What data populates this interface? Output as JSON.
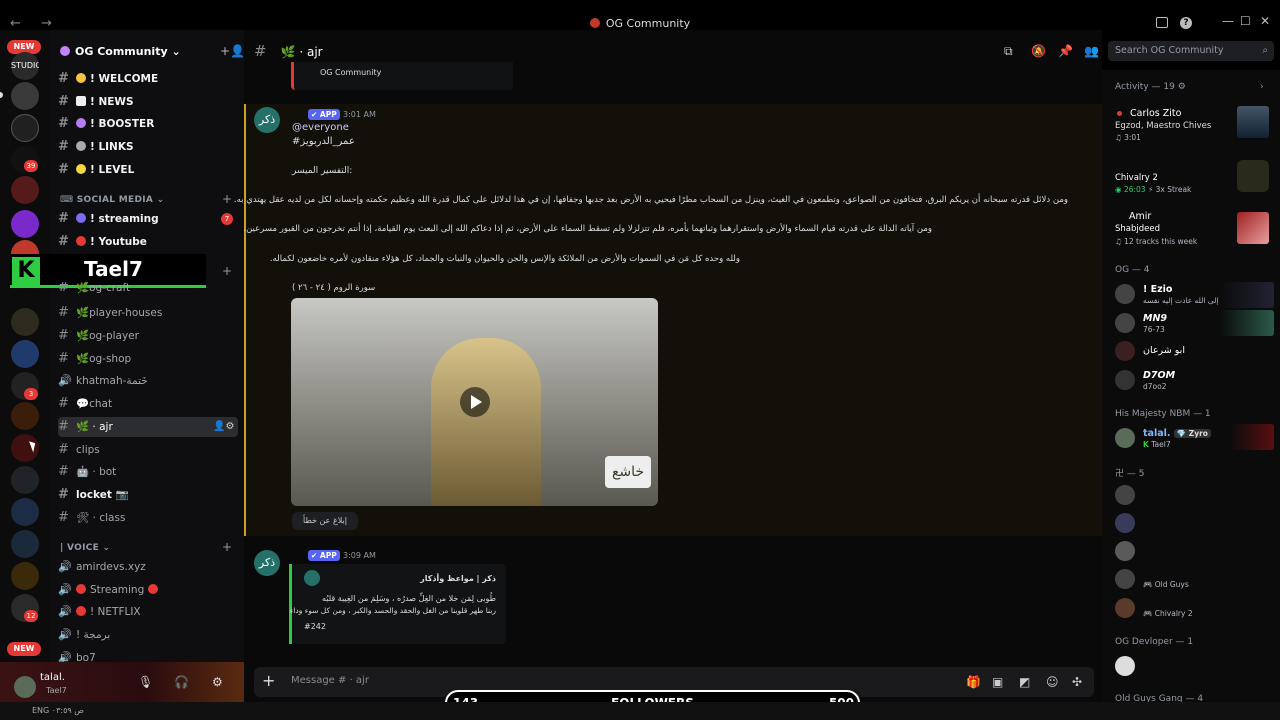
{
  "window": {
    "title": "OG Community",
    "nav": "← →"
  },
  "guild_badges": {
    "new_top": "NEW",
    "new_bottom": "NEW",
    "b1": "39",
    "b2": "8383",
    "b3": "3",
    "b4": "12",
    "studio": "STUDIO"
  },
  "server": {
    "name": "OG Community",
    "channels_top": [
      {
        "name": "! WELCOME",
        "icon_color": "#f5c542"
      },
      {
        "name": "! NEWS",
        "icon_color": "#eeeeee"
      },
      {
        "name": "! BOOSTER",
        "icon_color": "#b57cf5"
      },
      {
        "name": "! LINKS",
        "icon_color": "#aaaaaa"
      },
      {
        "name": "! LEVEL",
        "icon_color": "#f5d742"
      }
    ],
    "social_category": "SOCIAL MEDIA",
    "social": [
      {
        "name": "! streaming",
        "badge": "7"
      },
      {
        "name": "! Youtube"
      }
    ],
    "og_channels": [
      "og-craft",
      "player-houses",
      "og-player",
      "og-shop"
    ],
    "khatmah": "khatmah-خَتمة",
    "chat": "chat",
    "ajr": "ajr",
    "clips": "clips",
    "bot": "bot",
    "locket": "locket",
    "class": "class",
    "voice_category": "| VOICE",
    "voice": [
      "amirdevs.xyz",
      "Streaming",
      "! NETFLIX",
      "! برمجة",
      "bo7"
    ]
  },
  "overlay": {
    "tael": "Tael7",
    "k": "K"
  },
  "user": {
    "name": "talal.",
    "sub": "Tael7"
  },
  "channel": {
    "name": "ajr",
    "search_placeholder": "Search OG Community"
  },
  "messages": {
    "embed_top": "OG Community",
    "m1": {
      "avatar": "ذكر",
      "badge": "APP",
      "time": "3:01 AM",
      "everyone": "@everyone",
      "tag": "#عمر_الدربويز",
      "heading": "التفسير الميسر:",
      "p1": "ومن دلائل قدرته سبحانه أن يريكم البرق، فتخافون من الصواعق، وتطمعون في الغيث، وينزل من السحاب مطرًا فيحيي به الأرض بعد جدبها وجفافها، إن في هذا لدلائل على كمال قدرة الله وعظيم حكمته وإحسانه لكل من لديه عقل يهتدي به.",
      "p2": "ومن آياته الدالة على قدرته قيام السماء والأرض واستقرارهما وثباتهما بأمره، فلم تتزلزلا ولم تسقط السماء على الأرض، ثم إذا دعاكم الله إلى البعث يوم القيامة، إذا أنتم تخرجون من القبور مسرعين.",
      "p3": "ولله وحده كل مَن في السموات والأرض من الملائكة والإنس والجن والحيوان والنبات والجماد، كل هؤلاء منقادون لأمره خاضعون لكماله.",
      "surah": "سورة الروم ( ٢٤ - ٢٦ )",
      "watermark": "خاشع",
      "reaction": "إبلاغ عن خطأ"
    },
    "m2": {
      "avatar": "ذكر",
      "badge": "APP",
      "time": "3:09 AM",
      "title": "ذكر | مواعظ وأذكار",
      "l1": "طُوبى لِمَن خلا من الغِلِّ صدرُه ، وسَلِمَ من الغِيبة قلبُه",
      "l2": "ربنا طهر قلوبنا من الغل والحقد والحسد والكبر ، ومن كل سوء وداء",
      "num": "#242"
    }
  },
  "composer": {
    "placeholder": "Message # · ajr"
  },
  "members": {
    "activity_header": "Activity — 19",
    "activity": [
      {
        "name": "Carlos Zito",
        "sub": "Egzod, Maestro Chives",
        "extra": "3:01"
      },
      {
        "name": "Chivalry 2",
        "sub": "26:03",
        "extra": "3x Streak"
      },
      {
        "name": "Amir",
        "sub": "Shabjdeed",
        "extra": "12 tracks this week"
      }
    ],
    "og_header": "OG — 4",
    "og": [
      {
        "name": "! Ezio",
        "sub": "من عاد إلى الله عادت إليه نفسه"
      },
      {
        "name": "MN9",
        "sub": "76-73"
      },
      {
        "name": "ابو شرعان",
        "sub": ""
      },
      {
        "name": "D7OM",
        "sub": "d7oo2"
      }
    ],
    "nbm_header": "His Majesty NBM — 1",
    "nbm": {
      "name": "talal.",
      "tag": "Zyro",
      "sub": "Tael7"
    },
    "five_header": "卍 — 5",
    "five": [
      {
        "sub": "Old Guys"
      },
      {
        "sub": "Chivalry 2"
      }
    ],
    "dev_header": "OG Devloper — 1",
    "old_header": "Old Guys Gang — 4"
  },
  "followers": {
    "left": "143",
    "label": "FOLLOWERS",
    "right": "500"
  },
  "taskbar": {
    "left": "ENG  ص ٠٣:٥٩"
  }
}
